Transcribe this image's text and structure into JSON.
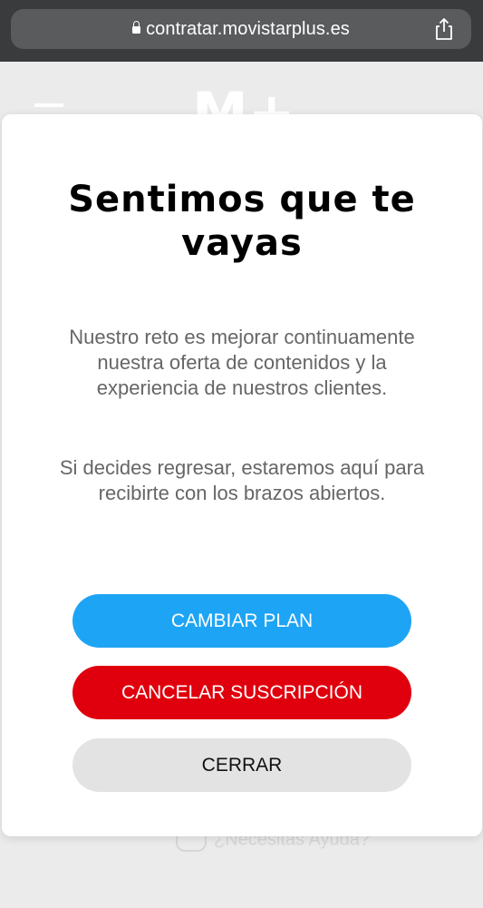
{
  "browser": {
    "url": "contratar.movistarplus.es",
    "lock_icon": "lock-icon",
    "share_icon": "share-icon"
  },
  "background_page": {
    "logo": "M+",
    "help_text": "¿Necesitas Ayuda?"
  },
  "modal": {
    "title": "Sentimos que te vayas",
    "paragraph1": "Nuestro reto es mejorar continuamente nuestra oferta de contenidos y la experiencia de nuestros clientes.",
    "paragraph2": "Si decides regresar, estaremos aquí para recibirte con los brazos abiertos.",
    "buttons": {
      "change_plan": "CAMBIAR PLAN",
      "cancel_subscription": "CANCELAR SUSCRIPCIÓN",
      "close": "CERRAR"
    }
  },
  "colors": {
    "primary_blue": "#1ea4f5",
    "danger_red": "#e0000d",
    "neutral_gray": "#e3e3e3"
  }
}
